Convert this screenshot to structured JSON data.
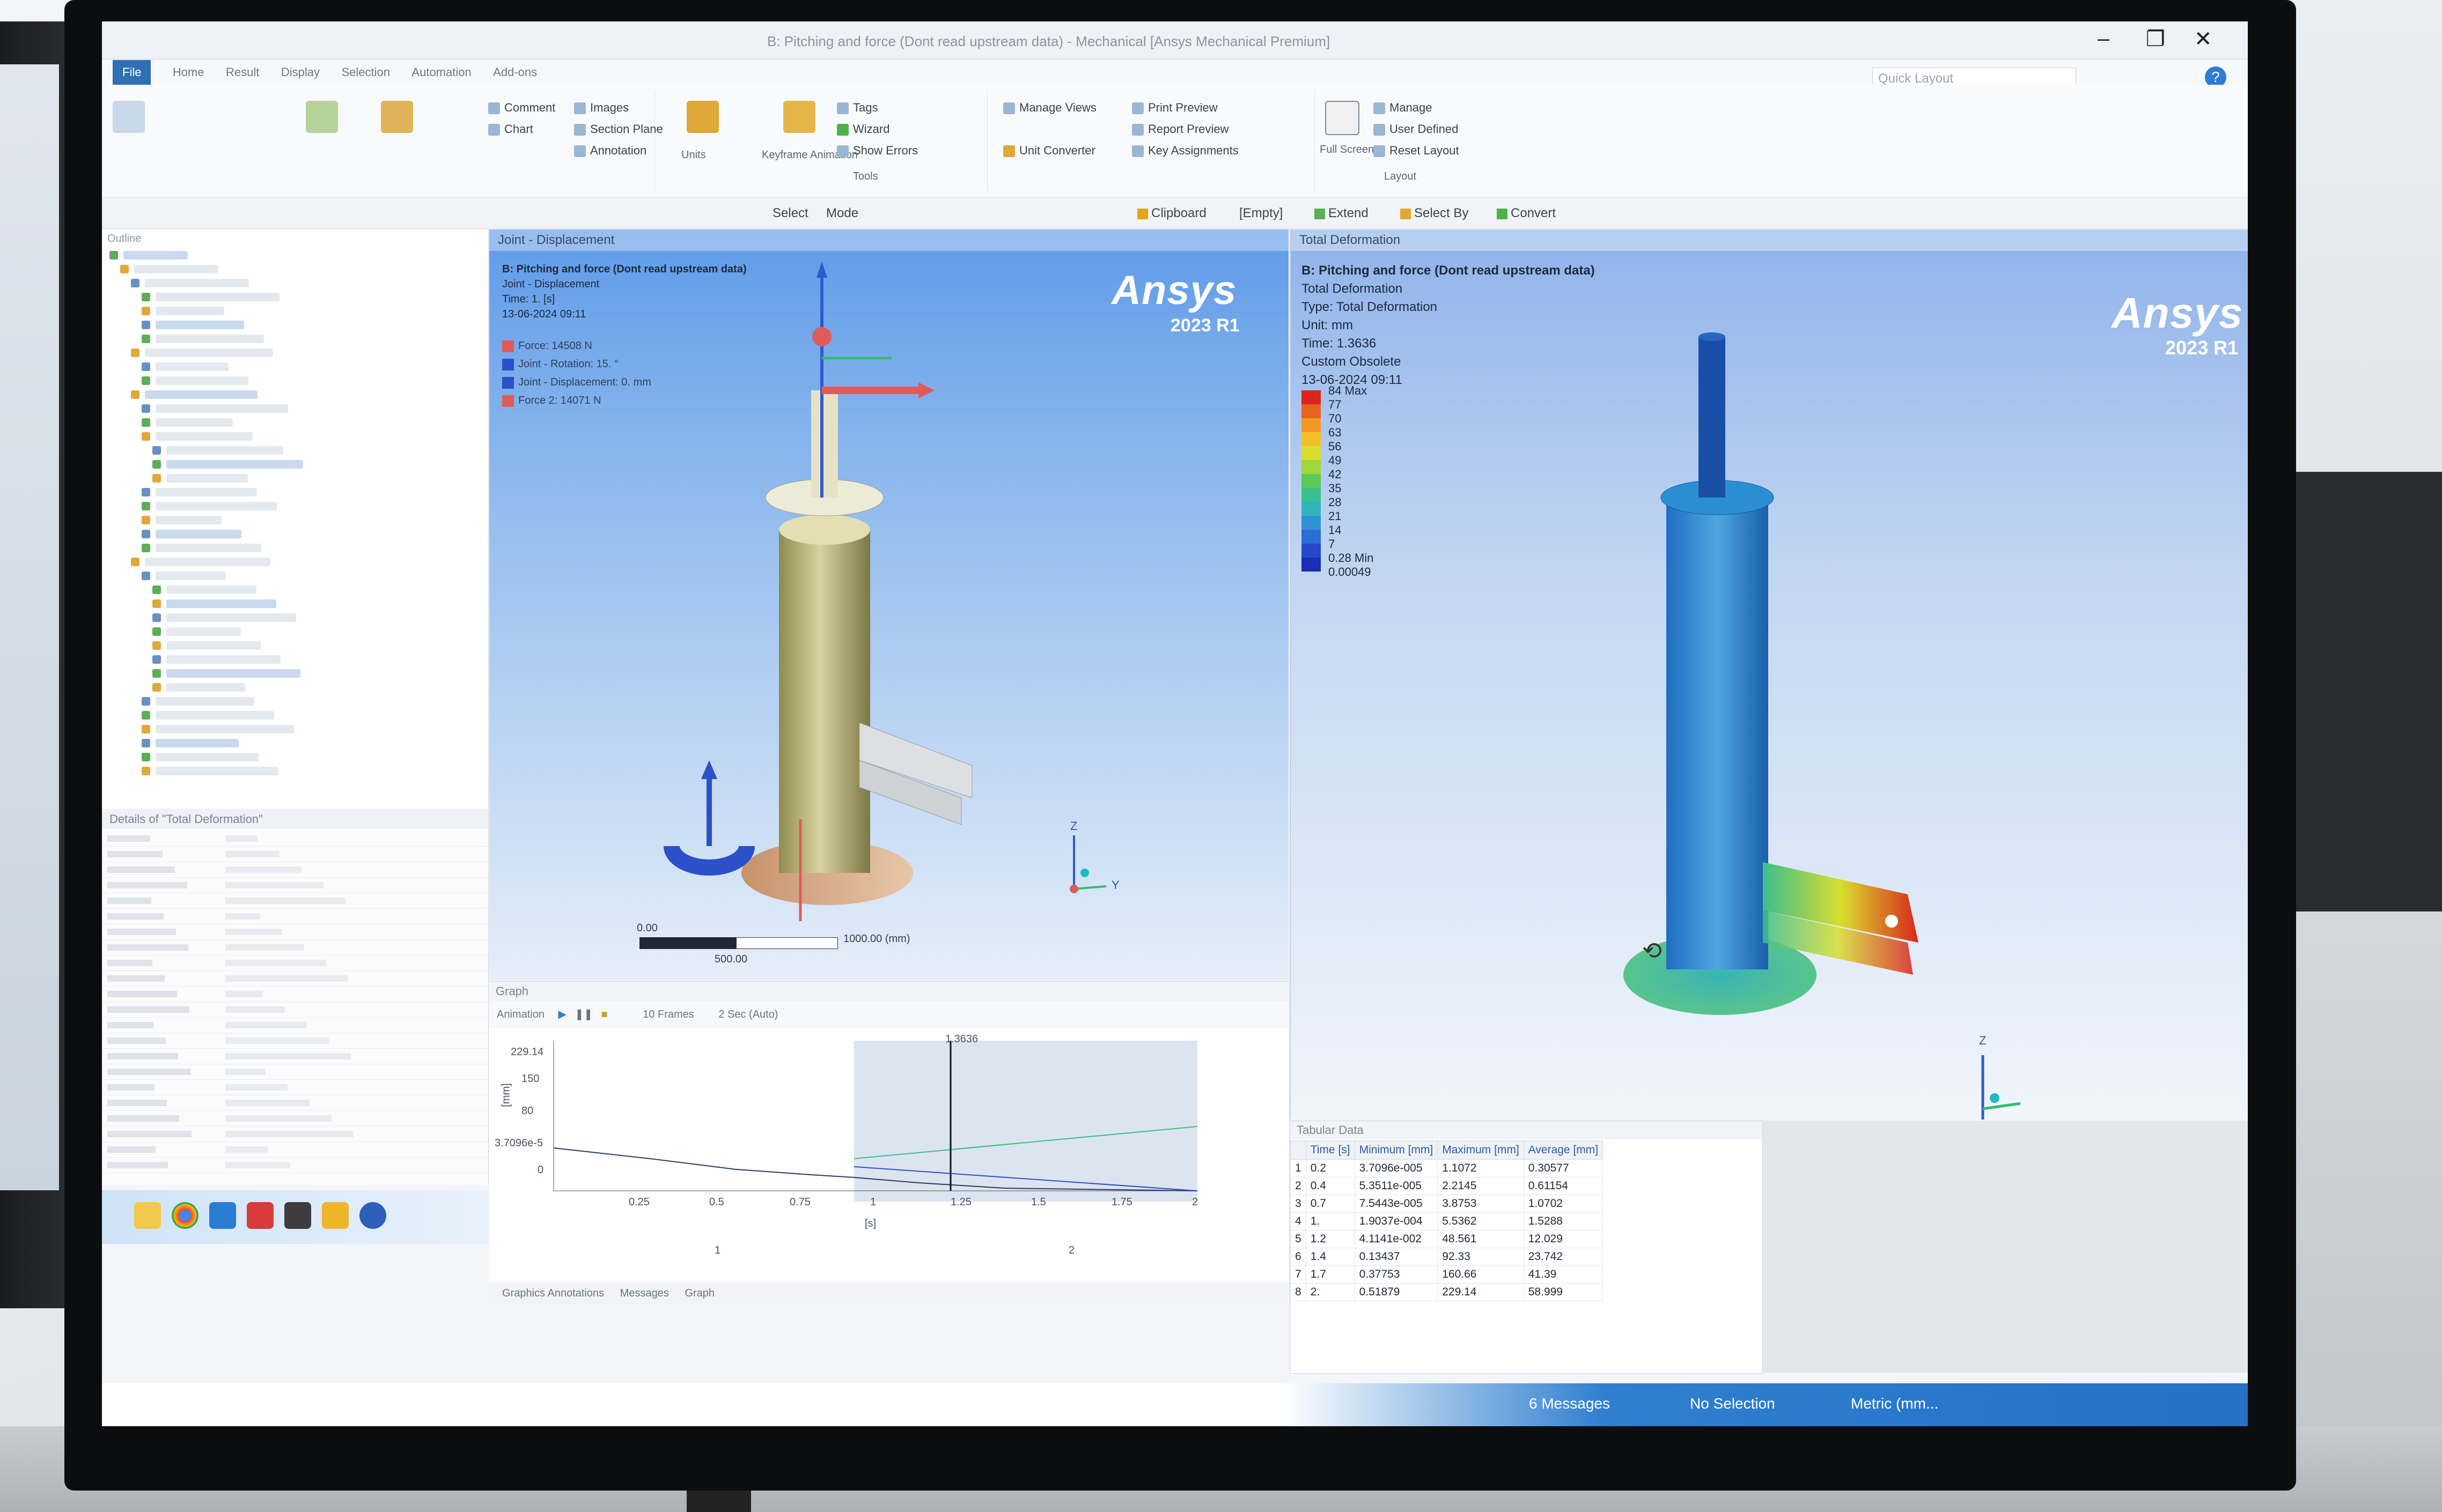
{
  "window": {
    "title": "B: Pitching and force (Dont read upstream data) - Mechanical [Ansys Mechanical Premium]",
    "quick_layout_placeholder": "Quick Layout",
    "help": "?",
    "minimize": "–",
    "restore": "❐",
    "close": "✕"
  },
  "ribbon": {
    "tabs": [
      "File",
      "Home",
      "Result",
      "Display",
      "Selection",
      "Automation",
      "Add-ons"
    ],
    "active_tab": "File",
    "items": {
      "tags": "Tags",
      "wizard": "Wizard",
      "show_errors": "Show Errors",
      "manage_views": "Manage Views",
      "unit_converter": "Unit Converter",
      "print_preview": "Print Preview",
      "report_preview": "Report Preview",
      "key_assignments": "Key Assignments",
      "full_screen": "Full Screen",
      "manage": "Manage",
      "user_defined": "User Defined",
      "reset_layout": "Reset Layout",
      "layout_group": "Layout",
      "tools_group": "Tools",
      "keyframe_animation": "Keyframe Animation",
      "units": "Units",
      "comment": "Comment",
      "images": "Images",
      "section_plane": "Section Plane",
      "annotation": "Annotation",
      "chart": "Chart"
    }
  },
  "toolbar": {
    "select": "Select",
    "mode": "Mode",
    "clipboard": "Clipboard",
    "empty": "[Empty]",
    "extend": "Extend",
    "select_by": "Select By",
    "convert": "Convert"
  },
  "left_viewport": {
    "tab": "Joint - Displacement",
    "info_title": "B: Pitching and force (Dont read upstream data)",
    "info_lines": [
      "Joint - Displacement",
      "Time: 1. [s]",
      "13-06-2024 09:11"
    ],
    "legend": [
      {
        "label": "Force: 14508 N",
        "color": "#e05a5a"
      },
      {
        "label": "Joint - Rotation: 15. °",
        "color": "#2b50c8"
      },
      {
        "label": "Joint - Displacement: 0. mm",
        "color": "#2b50c8"
      },
      {
        "label": "Force 2: 14071 N",
        "color": "#e05a5a"
      }
    ],
    "logo": "Ansys",
    "version": "2023 R1",
    "scale_start": "0.00",
    "scale_mid": "500.00",
    "scale_end": "1000.00 (mm)",
    "triad_z": "Z",
    "triad_y": "Y"
  },
  "right_viewport": {
    "tab": "Total Deformation",
    "info_title": "B: Pitching and force (Dont read upstream data)",
    "info_lines": [
      "Total Deformation",
      "Type: Total Deformation",
      "Unit: mm",
      "Time: 1.3636",
      "Custom Obsolete",
      "13-06-2024 09:11"
    ],
    "logo": "Ansys",
    "version": "2023 R1",
    "legend_labels": [
      "84 Max",
      "77",
      "70",
      "63",
      "56",
      "49",
      "42",
      "35",
      "28",
      "21",
      "14",
      "7",
      "0.28 Min",
      "0.00049"
    ],
    "legend_colors": [
      "#d9261c",
      "#e8631e",
      "#f09a23",
      "#f2c12a",
      "#d9de2e",
      "#9fd63a",
      "#5cc955",
      "#3bbf8e",
      "#31b3bf",
      "#2f93d3",
      "#2b6fd6",
      "#2448c9",
      "#1b2fb3"
    ],
    "triad_z": "Z"
  },
  "graph": {
    "header": "Graph",
    "animation": "Animation",
    "frames": "10 Frames",
    "speed": "2 Sec (Auto)",
    "y_top": "229.14",
    "y_150": "150",
    "y_80": "80",
    "y_min": "3.7096e-5",
    "y_0": "0",
    "cursor_label": "1.3636",
    "x_ticks": [
      "0.25",
      "0.5",
      "0.75",
      "1",
      "1.25",
      "1.5",
      "1.75",
      "2"
    ],
    "x_unit": "[s]",
    "y_unit": "[mm]",
    "bottom_index": "1",
    "bottom_index2": "2"
  },
  "tabular": {
    "header": "Tabular Data",
    "columns": [
      "",
      "Time [s]",
      "Minimum [mm]",
      "Maximum [mm]",
      "Average [mm]"
    ],
    "rows": [
      [
        "1",
        "0.2",
        "3.7096e-005",
        "1.1072",
        "0.30577"
      ],
      [
        "2",
        "0.4",
        "5.3511e-005",
        "2.2145",
        "0.61154"
      ],
      [
        "3",
        "0.7",
        "7.5443e-005",
        "3.8753",
        "1.0702"
      ],
      [
        "4",
        "1.",
        "1.9037e-004",
        "5.5362",
        "1.5288"
      ],
      [
        "5",
        "1.2",
        "4.1141e-002",
        "48.561",
        "12.029"
      ],
      [
        "6",
        "1.4",
        "0.13437",
        "92.33",
        "23.742"
      ],
      [
        "7",
        "1.7",
        "0.37753",
        "160.66",
        "41.39"
      ],
      [
        "8",
        "2.",
        "0.51879",
        "229.14",
        "58.999"
      ]
    ]
  },
  "bottom_tabs": [
    "Graphics Annotations",
    "Messages",
    "Graph"
  ],
  "status": {
    "messages": "6 Messages",
    "selection": "No Selection",
    "units": "Metric (mm..."
  },
  "outline": {
    "header": "Outline",
    "details_header": "Details of \"Total Deformation\""
  }
}
